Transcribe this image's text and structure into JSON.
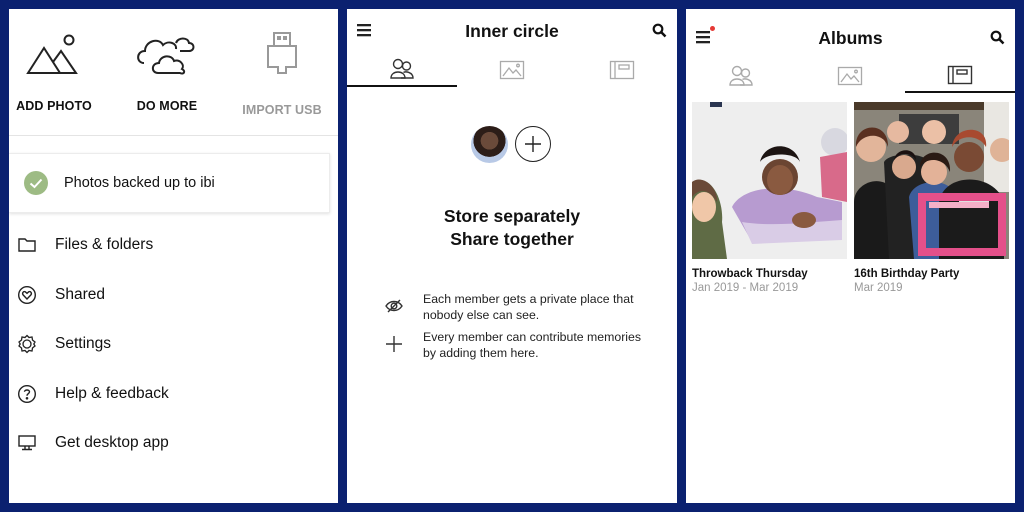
{
  "colors": {
    "frame": "#0b2170",
    "check_green": "#9dbb84",
    "notification_dot": "#e53935",
    "muted_text": "#999999"
  },
  "panel1": {
    "actions": [
      {
        "label": "ADD PHOTO",
        "icon": "mountain-photo-icon",
        "enabled": true
      },
      {
        "label": "DO MORE",
        "icon": "clouds-icon",
        "enabled": true
      },
      {
        "label": "IMPORT USB",
        "icon": "usb-icon",
        "enabled": false
      }
    ],
    "backup_status": {
      "text": "Photos backed up to ibi",
      "icon": "check-circle-icon"
    },
    "menu": [
      {
        "label": "Files & folders",
        "icon": "folder-icon"
      },
      {
        "label": "Shared",
        "icon": "heart-circle-icon"
      },
      {
        "label": "Settings",
        "icon": "gear-icon"
      },
      {
        "label": "Help & feedback",
        "icon": "help-circle-icon"
      },
      {
        "label": "Get desktop app",
        "icon": "desktop-icon"
      }
    ]
  },
  "panel2": {
    "header": {
      "title": "Inner circle",
      "menu_icon": "hamburger-icon",
      "search_icon": "search-icon"
    },
    "tabs": [
      {
        "icon": "people-icon",
        "active": true
      },
      {
        "icon": "photo-icon",
        "active": false
      },
      {
        "icon": "album-icon",
        "active": false
      }
    ],
    "tagline": {
      "line1": "Store separately",
      "line2": "Share together"
    },
    "features": [
      {
        "icon": "eye-off-icon",
        "line1": "Each member gets a private place that",
        "line2": "nobody else can see."
      },
      {
        "icon": "plus-icon",
        "line1": "Every member can contribute memories",
        "line2": "by adding them here."
      }
    ]
  },
  "panel3": {
    "header": {
      "title": "Albums",
      "menu_icon": "hamburger-icon",
      "search_icon": "search-icon",
      "has_notification": true
    },
    "tabs": [
      {
        "icon": "people-icon",
        "active": false
      },
      {
        "icon": "photo-icon",
        "active": false
      },
      {
        "icon": "album-icon",
        "active": true
      }
    ],
    "albums": [
      {
        "name": "Throwback Thursday",
        "date": "Jan 2019 - Mar 2019"
      },
      {
        "name": "16th Birthday Party",
        "date": "Mar 2019"
      }
    ]
  }
}
